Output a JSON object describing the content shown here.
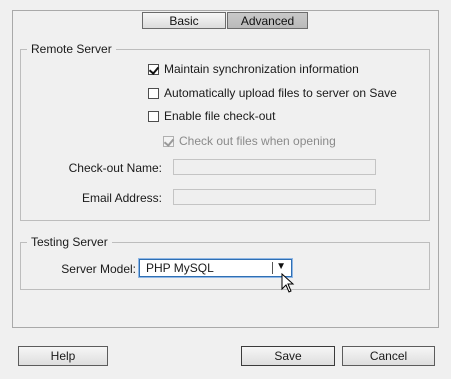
{
  "tabs": {
    "basic": "Basic",
    "advanced": "Advanced",
    "active": "Advanced"
  },
  "remote_server": {
    "legend": "Remote Server",
    "maintain_sync": {
      "label": "Maintain synchronization information",
      "checked": true
    },
    "auto_upload": {
      "label": "Automatically upload files to server on Save",
      "checked": false
    },
    "file_checkout": {
      "label": "Enable file check-out",
      "checked": false
    },
    "checkout_on_open": {
      "label": "Check out files when opening",
      "checked": true,
      "disabled": true
    },
    "checkout_name": {
      "label": "Check-out Name:",
      "value": ""
    },
    "email_address": {
      "label": "Email Address:",
      "value": ""
    }
  },
  "testing_server": {
    "legend": "Testing Server",
    "server_model_label": "Server Model:",
    "server_model_value": "PHP MySQL"
  },
  "buttons": {
    "help": "Help",
    "save": "Save",
    "cancel": "Cancel"
  }
}
